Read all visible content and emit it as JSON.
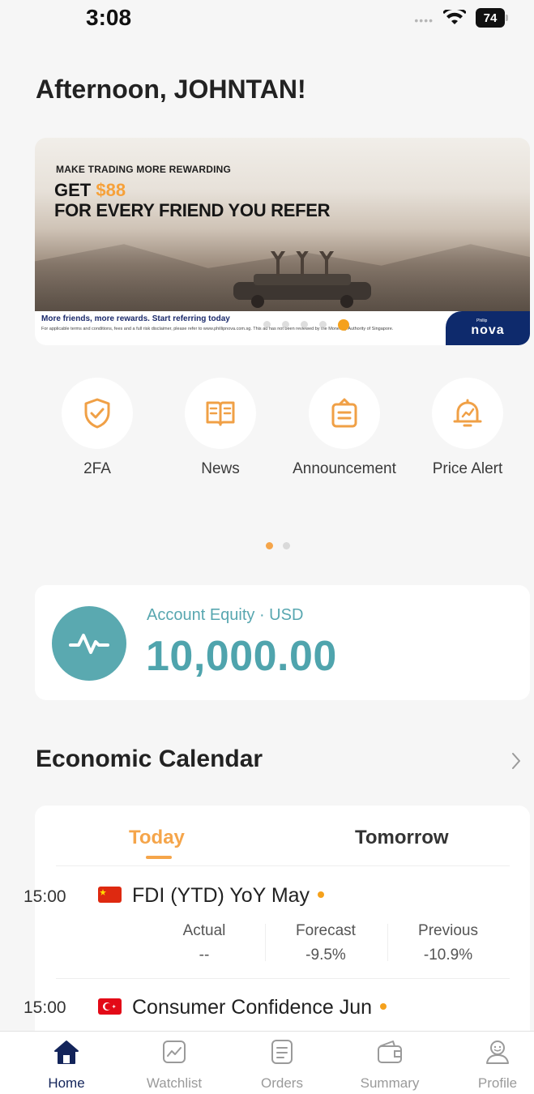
{
  "status_bar": {
    "time": "3:08",
    "battery": "74"
  },
  "greeting": "Afternoon, JOHNTAN!",
  "banner": {
    "subtitle": "MAKE TRADING MORE REWARDING",
    "headline_prefix": "GET ",
    "headline_amount": "$88",
    "headline_line2": "FOR EVERY FRIEND YOU REFER",
    "footer_title": "More friends, more rewards. Start referring today",
    "footer_note": "For applicable terms and conditions, fees and a full risk disclaimer, please refer to www.phillipnova.com.sg. This ad has not been reviewed by the Monetary Authority of Singapore.",
    "brand_small": "Phillip",
    "brand_name": "nova",
    "slide_count": 5,
    "active_slide": 5,
    "accent_color": "#f5a11c"
  },
  "quick_actions": [
    {
      "label": "2FA",
      "icon": "shield-check-icon"
    },
    {
      "label": "News",
      "icon": "book-icon"
    },
    {
      "label": "Announcement",
      "icon": "clipboard-icon"
    },
    {
      "label": "Price Alert",
      "icon": "bell-chart-icon"
    }
  ],
  "quick_actions_pager": {
    "pages": 2,
    "active": 1
  },
  "account": {
    "label": "Account Equity · USD",
    "equity": "10,000.00",
    "icon": "pulse-icon",
    "color": "#4fa4ad"
  },
  "economic_calendar": {
    "title": "Economic Calendar",
    "tabs": {
      "today": "Today",
      "tomorrow": "Tomorrow",
      "active": "today"
    },
    "column_headers": {
      "actual": "Actual",
      "forecast": "Forecast",
      "previous": "Previous"
    },
    "events": [
      {
        "time": "15:00",
        "flag": "china-flag-icon",
        "name": "FDI (YTD) YoY May",
        "actual": "--",
        "forecast": "-9.5%",
        "previous": "-10.9%"
      },
      {
        "time": "15:00",
        "flag": "turkey-flag-icon",
        "name": "Consumer Confidence Jun"
      }
    ]
  },
  "tab_bar": [
    {
      "label": "Home",
      "icon": "home-icon",
      "active": true
    },
    {
      "label": "Watchlist",
      "icon": "chart-icon",
      "active": false
    },
    {
      "label": "Orders",
      "icon": "document-icon",
      "active": false
    },
    {
      "label": "Summary",
      "icon": "wallet-icon",
      "active": false
    },
    {
      "label": "Profile",
      "icon": "user-icon",
      "active": false
    }
  ],
  "colors": {
    "accent": "#f5a54a",
    "brand_navy": "#13245a",
    "teal": "#4fa4ad"
  }
}
